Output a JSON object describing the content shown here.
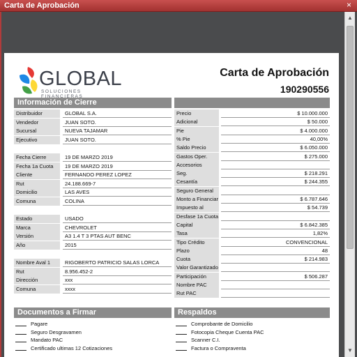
{
  "window": {
    "title": "Carta de Aprobación",
    "close_icon": "×"
  },
  "logo": {
    "word": "GLOBAL",
    "subtitle": "SOLUCIONES FINANCIERAS",
    "colors": [
      "#e53935",
      "#1e88e5",
      "#fdd835",
      "#43a047"
    ]
  },
  "header": {
    "title": "Carta de Aprobación",
    "number": "190290556"
  },
  "info_cierre": {
    "heading": "Información de Cierre",
    "left_groups": [
      [
        {
          "label": "Distribuidor",
          "value": "GLOBAL S.A."
        },
        {
          "label": "Vendedor",
          "value": "JUAN SOTO."
        },
        {
          "label": "Sucursal",
          "value": "NUEVA TAJAMAR"
        },
        {
          "label": "Ejecutivo",
          "value": "JUAN SOTO."
        }
      ],
      [
        {
          "label": "Fecha Cierre",
          "value": "19 DE MARZO 2019"
        },
        {
          "label": "Fecha 1a Cuota",
          "value": "19 DE MARZO 2019"
        },
        {
          "label": "Cliente",
          "value": "FERNANDO PEREZ LOPEZ"
        },
        {
          "label": "Rut",
          "value": "24.188.669-7"
        },
        {
          "label": "Domicilio",
          "value": "LAS AVES"
        },
        {
          "label": "Comuna",
          "value": "COLINA"
        }
      ],
      [
        {
          "label": "Estado",
          "value": "USADO"
        },
        {
          "label": "Marca",
          "value": "CHEVROLET"
        },
        {
          "label": "Versión",
          "value": "A3 1.4 T 3 PTAS AUT BENC"
        },
        {
          "label": "Año",
          "value": "2015"
        }
      ],
      [
        {
          "label": "Nombre Aval 1",
          "value": "RIGOBERTO PATRICIO SALAS LORCA"
        },
        {
          "label": "Rut",
          "value": "8.956.452-2"
        },
        {
          "label": "Dirección",
          "value": "xxx"
        },
        {
          "label": "Comuna",
          "value": "xxxx"
        }
      ]
    ],
    "right_rows": [
      {
        "label": "Precio",
        "value": "$ 10.000.000"
      },
      {
        "label": "Adicional",
        "value": "$ 50.000"
      },
      {
        "label": "Pie",
        "value": "$ 4.000.000"
      },
      {
        "label": "% Pie",
        "value": "40,00%"
      },
      {
        "label": "Saldo Precio",
        "value": "$ 6.050.000"
      },
      {
        "label": "Gastos Oper.",
        "value": "$ 275.000"
      },
      {
        "label": "Accesorios",
        "value": ""
      },
      {
        "label": "Seg. Desgravamen",
        "value": "$ 218.291"
      },
      {
        "label": "Cesantía",
        "value": "$ 244.355"
      },
      {
        "label": "Seguro General",
        "value": ""
      },
      {
        "label": "Monto a Financiar",
        "value": "$ 6.787.646"
      },
      {
        "label": "Impuesto al Pagare",
        "value": "$ 54.739"
      },
      {
        "label": "Desfase 1a Cuota",
        "value": ""
      },
      {
        "label": "Capital",
        "value": "$ 6.842.385"
      },
      {
        "label": "Tasa",
        "value": "1,82%"
      },
      {
        "label": "Tipo Crédito",
        "value": "CONVENCIONAL"
      },
      {
        "label": "Plazo",
        "value": "48"
      },
      {
        "label": "Cuota",
        "value": "$ 214.983"
      },
      {
        "label": "Valor Garantizado",
        "value": ""
      },
      {
        "label": "Participación",
        "value": "$ 506.287"
      },
      {
        "label": "Nombre PAC",
        "value": ""
      },
      {
        "label": "Rut PAC",
        "value": ""
      }
    ]
  },
  "documentos": {
    "heading": "Documentos a Firmar",
    "items": [
      "Pagare",
      "Seguro Desgravamen",
      "Mandato PAC",
      "Certificado ultimas 12 Cotizaciones"
    ]
  },
  "respaldos": {
    "heading": "Respaldos",
    "items": [
      "Comprobante de Domicilio",
      "Fotocopia Cheque Cuenta PAC",
      "Scanner C.I.",
      "Factura o Compraventa"
    ]
  }
}
